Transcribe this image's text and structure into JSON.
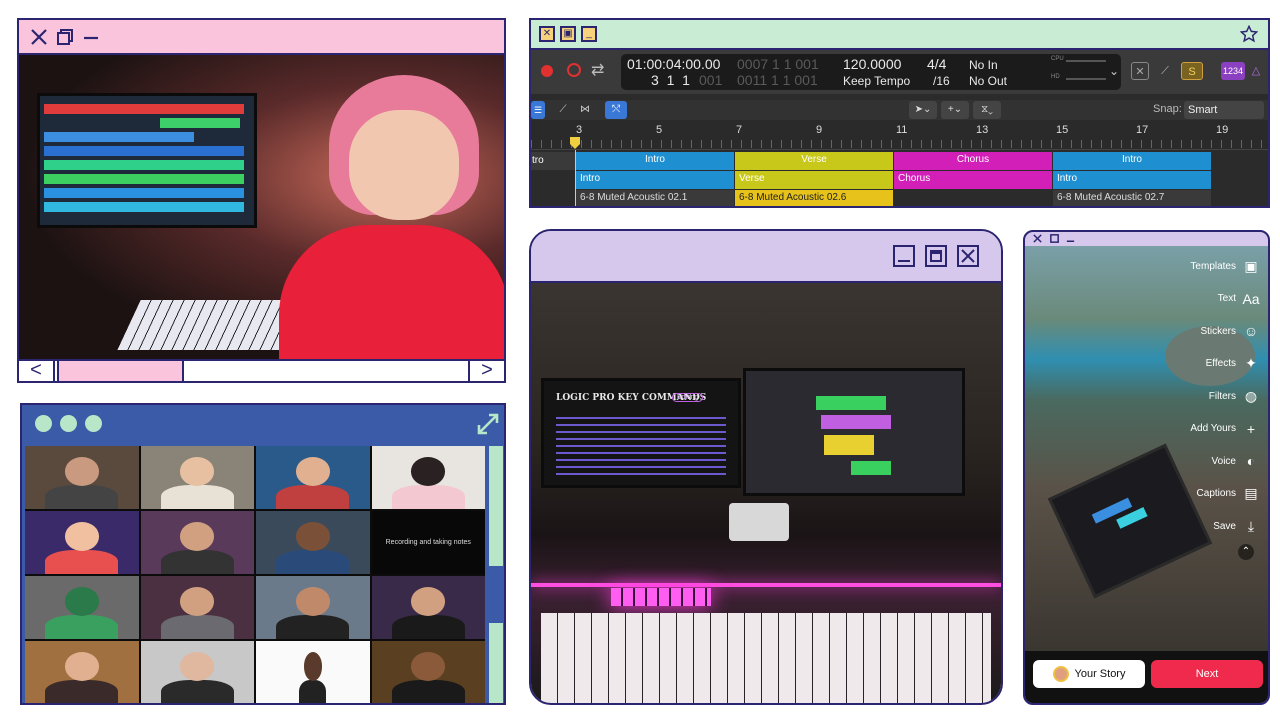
{
  "colors": {
    "outline": "#2b2470",
    "pink": "#f9c4dc",
    "mint": "#b8e6c8",
    "lavender": "#d6c8ec",
    "blue": "#3b5ba8"
  },
  "daw": {
    "position_time": "01:00:04:00.00",
    "time_faded": "0007 1 1 001",
    "position_bars": "3  1  1",
    "position_bars_sub": "001",
    "bars_faded": "0011 1 1 001",
    "tempo": "120.0000",
    "tempo_mode": "Keep Tempo",
    "time_sig": "4/4",
    "division": "/16",
    "midi_in": "No In",
    "midi_out": "No Out",
    "cpu_label": "CPU",
    "hd_label": "HD",
    "count_in": "1234",
    "snap_label": "Snap:",
    "snap_value": "Smart",
    "ruler": [
      "3",
      "5",
      "7",
      "9",
      "11",
      "13",
      "15",
      "17",
      "19"
    ],
    "markers": [
      {
        "label": "Intro",
        "color": "#1e8fd0"
      },
      {
        "label": "Verse",
        "color": "#c8c81a"
      },
      {
        "label": "Chorus",
        "color": "#d21fb8"
      },
      {
        "label": "Intro",
        "color": "#1e8fd0"
      }
    ],
    "arrangement": [
      {
        "label": "Intro",
        "color": "#1e8fd0"
      },
      {
        "label": "Verse",
        "color": "#c8c81a"
      },
      {
        "label": "Chorus",
        "color": "#d21fb8"
      },
      {
        "label": "Intro",
        "color": "#1e8fd0"
      }
    ],
    "partial_marker": "tro",
    "regions": [
      {
        "label": "6-8 Muted Acoustic 02.1",
        "color": "#3a3a3a"
      },
      {
        "label": "6-8 Muted Acoustic 02.6",
        "color": "#e6c21a"
      },
      {
        "label": "6-8 Muted Acoustic 02.7",
        "color": "#3a3a3a"
      }
    ]
  },
  "monitor_text": {
    "title": "LOGIC PRO KEY COMMANDS",
    "badge": "Editing"
  },
  "grid_text": {
    "caption": "Recording and taking notes"
  },
  "story": {
    "tools": [
      {
        "label": "Templates",
        "icon": "templates-icon",
        "glyph": "▣"
      },
      {
        "label": "Text",
        "icon": "text-icon",
        "glyph": "Aa"
      },
      {
        "label": "Stickers",
        "icon": "stickers-icon",
        "glyph": "☺"
      },
      {
        "label": "Effects",
        "icon": "effects-icon",
        "glyph": "✦"
      },
      {
        "label": "Filters",
        "icon": "filters-icon",
        "glyph": "◍"
      },
      {
        "label": "Add Yours",
        "icon": "add-yours-icon",
        "glyph": "+"
      },
      {
        "label": "Voice",
        "icon": "voice-icon",
        "glyph": "◐"
      },
      {
        "label": "Captions",
        "icon": "captions-icon",
        "glyph": "▤"
      },
      {
        "label": "Save",
        "icon": "save-icon",
        "glyph": "⤓"
      }
    ],
    "your_story": "Your Story",
    "next": "Next"
  }
}
